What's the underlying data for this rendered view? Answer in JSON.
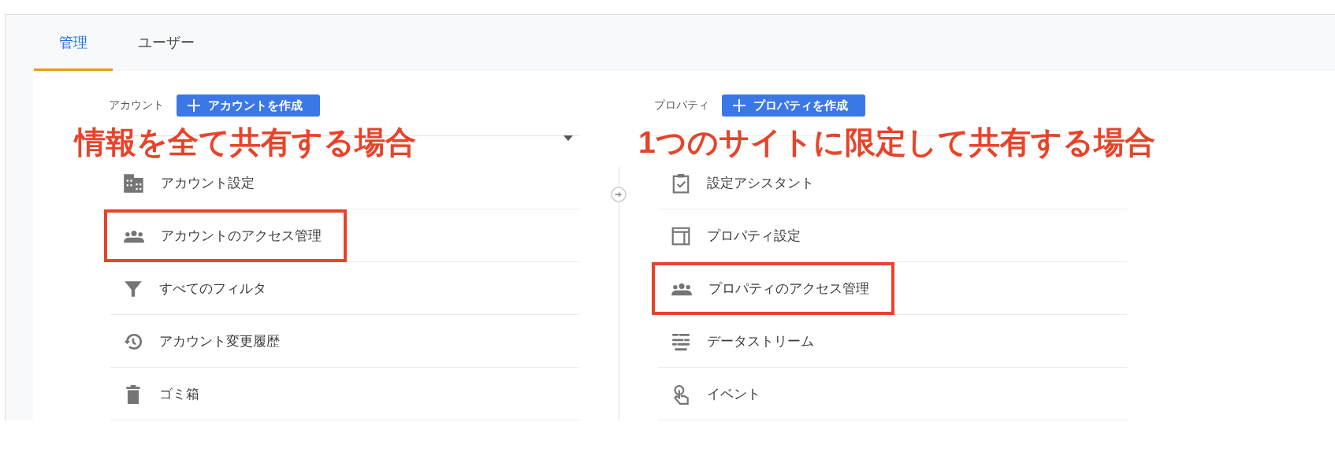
{
  "tabs": [
    {
      "label": "管理",
      "selected": true
    },
    {
      "label": "ユーザー",
      "selected": false
    }
  ],
  "columns": [
    {
      "title": "アカウント",
      "create_button": "アカウントを作成",
      "annotation": "情報を全て共有する場合",
      "dropdown_caret": true,
      "items": [
        {
          "kind": "building",
          "label": "アカウント設定",
          "highlighted": false
        },
        {
          "kind": "people",
          "label": "アカウントのアクセス管理",
          "highlighted": true
        },
        {
          "kind": "filter",
          "label": "すべてのフィルタ",
          "highlighted": false
        },
        {
          "kind": "history",
          "label": "アカウント変更履歴",
          "highlighted": false
        },
        {
          "kind": "trash",
          "label": "ゴミ箱",
          "highlighted": false
        }
      ]
    },
    {
      "title": "プロパティ",
      "create_button": "プロパティを作成",
      "annotation": "1つのサイトに限定して共有する場合",
      "dropdown_caret": false,
      "items": [
        {
          "kind": "clipboard",
          "label": "設定アシスタント",
          "highlighted": false
        },
        {
          "kind": "layout",
          "label": "プロパティ設定",
          "highlighted": false
        },
        {
          "kind": "people",
          "label": "プロパティのアクセス管理",
          "highlighted": true
        },
        {
          "kind": "stream",
          "label": "データストリーム",
          "highlighted": false
        },
        {
          "kind": "touch",
          "label": "イベント",
          "highlighted": false
        }
      ]
    }
  ]
}
